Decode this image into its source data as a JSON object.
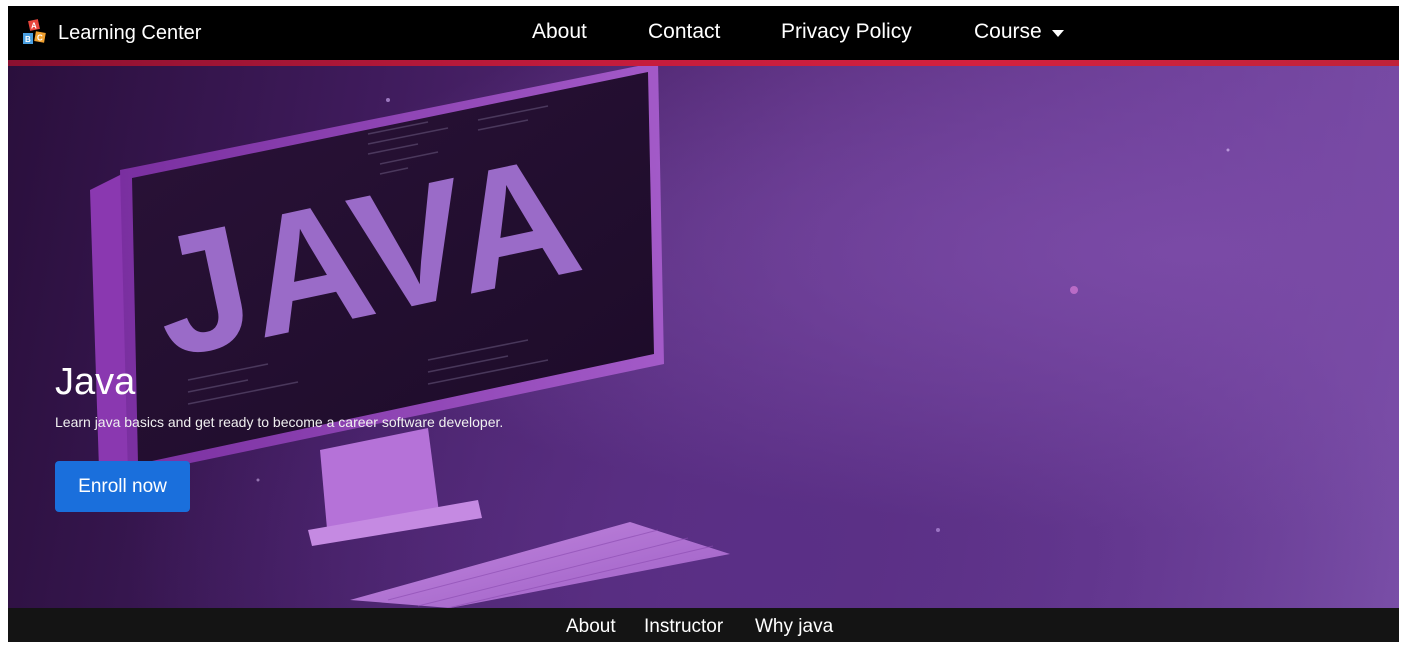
{
  "brand": {
    "name": "Learning Center",
    "logo_icon": "abc-blocks-icon"
  },
  "navbar": {
    "links": [
      "About",
      "Contact",
      "Privacy Policy",
      "Course"
    ],
    "course_dropdown_icon": "caret-down-icon"
  },
  "hero": {
    "artwork_text": "JAVA",
    "title": "Java",
    "subtitle": "Learn java basics and get ready to become a career software developer.",
    "cta_label": "Enroll now"
  },
  "subnav": {
    "links": [
      "About",
      "Instructor",
      "Why java"
    ]
  },
  "colors": {
    "navbar_bg": "#000000",
    "accent_bar": "#c21b3c",
    "button": "#1a6fdc",
    "hero_purple": "#5b3080",
    "subnav_bg": "#141414"
  }
}
